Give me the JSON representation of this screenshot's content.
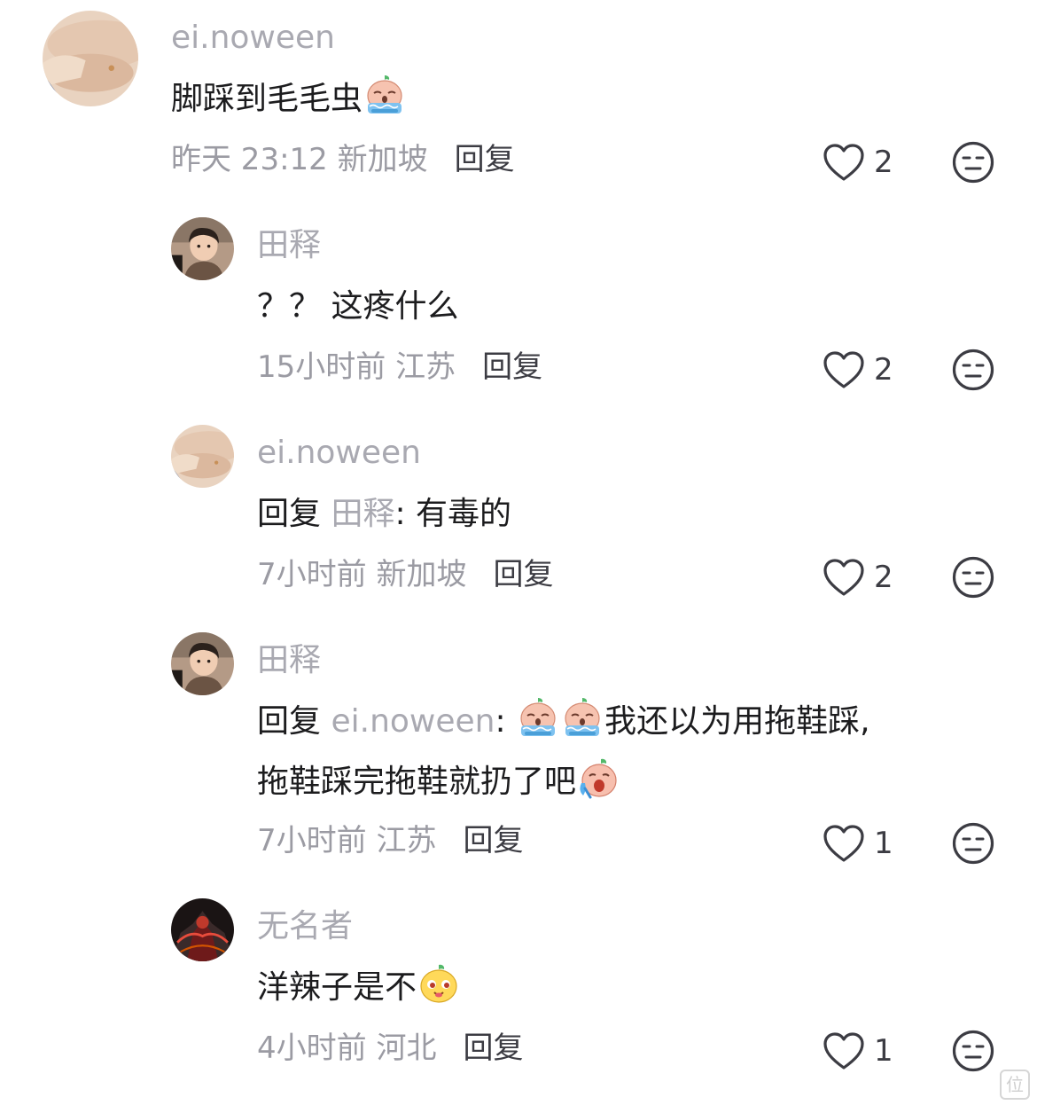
{
  "comments": [
    {
      "username": "ei.noween",
      "text": "脚踩到毛毛虫",
      "emojis": [
        "crying-emoji"
      ],
      "time": "昨天 23:12",
      "location": "新加坡",
      "reply_label": "回复",
      "likes": "2"
    },
    {
      "username": "田释",
      "text": "？？ 这疼什么",
      "time": "15小时前",
      "location": "江苏",
      "reply_label": "回复",
      "likes": "2"
    },
    {
      "username": "ei.noween",
      "reply_prefix": "回复",
      "mention": "田释",
      "text": ": 有毒的",
      "time": "7小时前",
      "location": "新加坡",
      "reply_label": "回复",
      "likes": "2"
    },
    {
      "username": "田释",
      "reply_prefix": "回复",
      "mention": "ei.noween",
      "line1_colon": ":",
      "line1_text": "我还以为用拖鞋踩,",
      "line2_text": "拖鞋踩完拖鞋就扔了吧",
      "emojis": [
        "crying-emoji",
        "crying-emoji",
        "sobbing-emoji"
      ],
      "time": "7小时前",
      "location": "江苏",
      "reply_label": "回复",
      "likes": "1"
    },
    {
      "username": "无名者",
      "text": "洋辣子是不",
      "emojis": [
        "smirking-emoji"
      ],
      "time": "4小时前",
      "location": "河北",
      "reply_label": "回复",
      "likes": "1"
    }
  ],
  "colors": {
    "username": "#a9a9b1",
    "text": "#1c1c1e",
    "meta": "#9b9ba3",
    "icon": "#3c3c43"
  },
  "icons": {
    "like": "heart-outline-icon",
    "dislike": "meh-face-icon"
  },
  "watermark_glyph": "位"
}
